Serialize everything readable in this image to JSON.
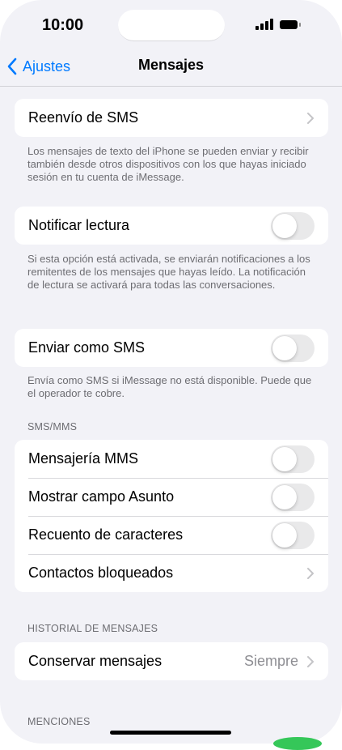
{
  "status_bar": {
    "time": "10:00"
  },
  "nav": {
    "back_label": "Ajustes",
    "title": "Mensajes"
  },
  "sections": {
    "reenvio": {
      "label": "Reenvío de SMS",
      "footer": "Los mensajes de texto del iPhone se pueden enviar y recibir también desde otros dispositivos con los que hayas iniciado sesión en tu cuenta de iMessage."
    },
    "notificar": {
      "label": "Notificar lectura",
      "enabled": false,
      "footer": "Si esta opción está activada, se enviarán notificaciones a los remitentes de los mensajes que hayas leído. La notificación de lectura se activará para todas las conversaciones."
    },
    "enviar_sms": {
      "label": "Enviar como SMS",
      "enabled": false,
      "footer": "Envía como SMS si iMessage no está disponible. Puede que el operador te cobre."
    },
    "sms_mms": {
      "header": "SMS/MMS",
      "mms": {
        "label": "Mensajería MMS",
        "enabled": false
      },
      "asunto": {
        "label": "Mostrar campo Asunto",
        "enabled": false
      },
      "recuento": {
        "label": "Recuento de caracteres",
        "enabled": false
      },
      "bloqueados": {
        "label": "Contactos bloqueados"
      }
    },
    "historial": {
      "header": "HISTORIAL DE MENSAJES",
      "conservar": {
        "label": "Conservar mensajes",
        "value": "Siempre"
      }
    },
    "menciones": {
      "header": "MENCIONES"
    }
  },
  "colors": {
    "accent": "#007aff",
    "background": "#f2f2f7",
    "toggle_off": "#e9e9ea"
  },
  "icons": [
    "signal-icon",
    "battery-icon",
    "chevron-left-icon",
    "chevron-right-icon"
  ]
}
